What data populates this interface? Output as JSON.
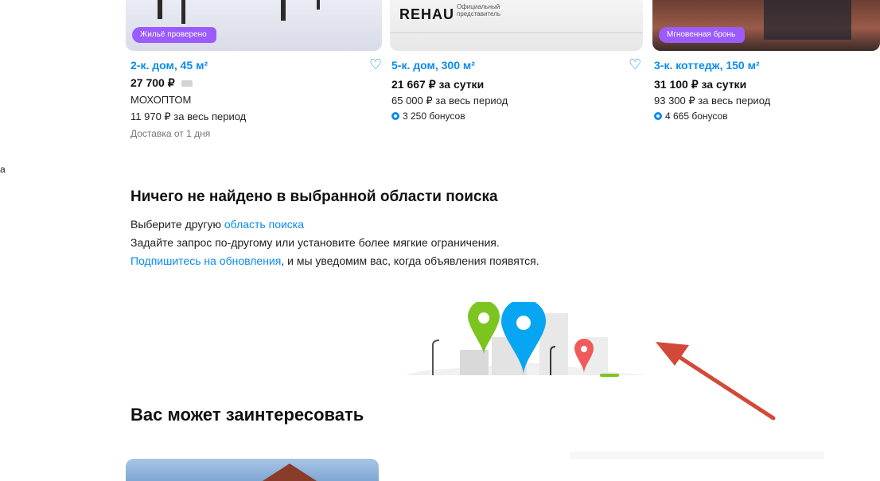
{
  "cards": [
    {
      "tag": "Жильё проверено",
      "title": "2-к. дом, 45 м²",
      "price": "27 700 ₽",
      "line1": "МОХОПТОМ",
      "line2": "11 970 ₽ за весь период",
      "line3": "Доставка от 1 дня"
    },
    {
      "brand": "REHAU",
      "brand_sub": "Официальный представитель",
      "title": "5-к. дом, 300 м²",
      "price": "21 667 ₽ за сутки",
      "line1": "65 000 ₽ за весь период",
      "bonus": "3 250 бонусов"
    },
    {
      "tag": "Мгновенная бронь",
      "title": "3-к. коттедж, 150 м²",
      "price": "31 100 ₽ за сутки",
      "line1": "93 300 ₽ за весь период",
      "bonus": "4 665 бонусов"
    }
  ],
  "left_edge_char": "а",
  "empty_state": {
    "heading": "Ничего не найдено в выбранной области поиска",
    "line1_text": "Выберите другую ",
    "line1_link": "область поиска",
    "line2_text": "Задайте запрос по-другому или установите более мягкие ограничения.",
    "line3_link": "Подпишитесь на обновления",
    "line3_text": ", и мы уведомим вас, когда объявления появятся."
  },
  "recommend_heading": "Вас может заинтересовать",
  "colors": {
    "accent": "#0a8bf0",
    "arrow": "#d2493a",
    "pin_green": "#7cc520",
    "pin_blue": "#06a6f2",
    "pin_red": "#f05a5a",
    "tag_purple": "#9b5bff"
  },
  "icons": [
    "heart-icon",
    "bonus-icon",
    "location-pin-icon",
    "red-arrow-annotation"
  ]
}
